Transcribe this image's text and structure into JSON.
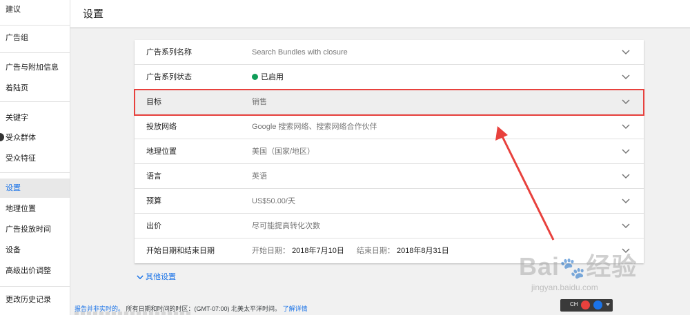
{
  "sidebar": {
    "items": [
      {
        "label": "建议",
        "active": false
      },
      {
        "label": "广告组",
        "active": false
      },
      {
        "label": "广告与附加信息",
        "active": false
      },
      {
        "label": "着陆页",
        "active": false
      },
      {
        "label": "关键字",
        "active": false
      },
      {
        "label": "受众群体",
        "active": false
      },
      {
        "label": "受众特征",
        "active": false
      },
      {
        "label": "设置",
        "active": true
      },
      {
        "label": "地理位置",
        "active": false
      },
      {
        "label": "广告投放时间",
        "active": false
      },
      {
        "label": "设备",
        "active": false
      },
      {
        "label": "高级出价调整",
        "active": false
      },
      {
        "label": "更改历史记录",
        "active": false
      }
    ]
  },
  "header": {
    "title": "设置"
  },
  "settings": {
    "rows": [
      {
        "label": "广告系列名称",
        "value": "Search Bundles with closure"
      },
      {
        "label": "广告系列状态",
        "value": "已启用",
        "status_color": "#0f9d58"
      },
      {
        "label": "目标",
        "value": "销售",
        "highlighted": true
      },
      {
        "label": "投放网络",
        "value": "Google 搜索网络、搜索网络合作伙伴"
      },
      {
        "label": "地理位置",
        "value": "美国（国家/地区）"
      },
      {
        "label": "语言",
        "value": "英语"
      },
      {
        "label": "预算",
        "value": "US$50.00/天"
      },
      {
        "label": "出价",
        "value": "尽可能提高转化次数"
      },
      {
        "label": "开始日期和结束日期",
        "start_label": "开始日期：",
        "start_date": "2018年7月10日",
        "end_label": "结束日期：",
        "end_date": "2018年8月31日"
      }
    ],
    "more_settings": "其他设置"
  },
  "footer": {
    "notice_link": "报告并非实时的。",
    "timezone": "所有日期和时间的时区：(GMT-07:00) 北美太平洋时间。",
    "learn_more": "了解详情"
  },
  "ime": {
    "label": "CH"
  },
  "watermark": {
    "logo": "Bai 经验",
    "url": "jingyan.baidu.com"
  },
  "colors": {
    "accent": "#1a73e8",
    "annotation": "#e8413d",
    "status_enabled": "#0f9d58"
  }
}
